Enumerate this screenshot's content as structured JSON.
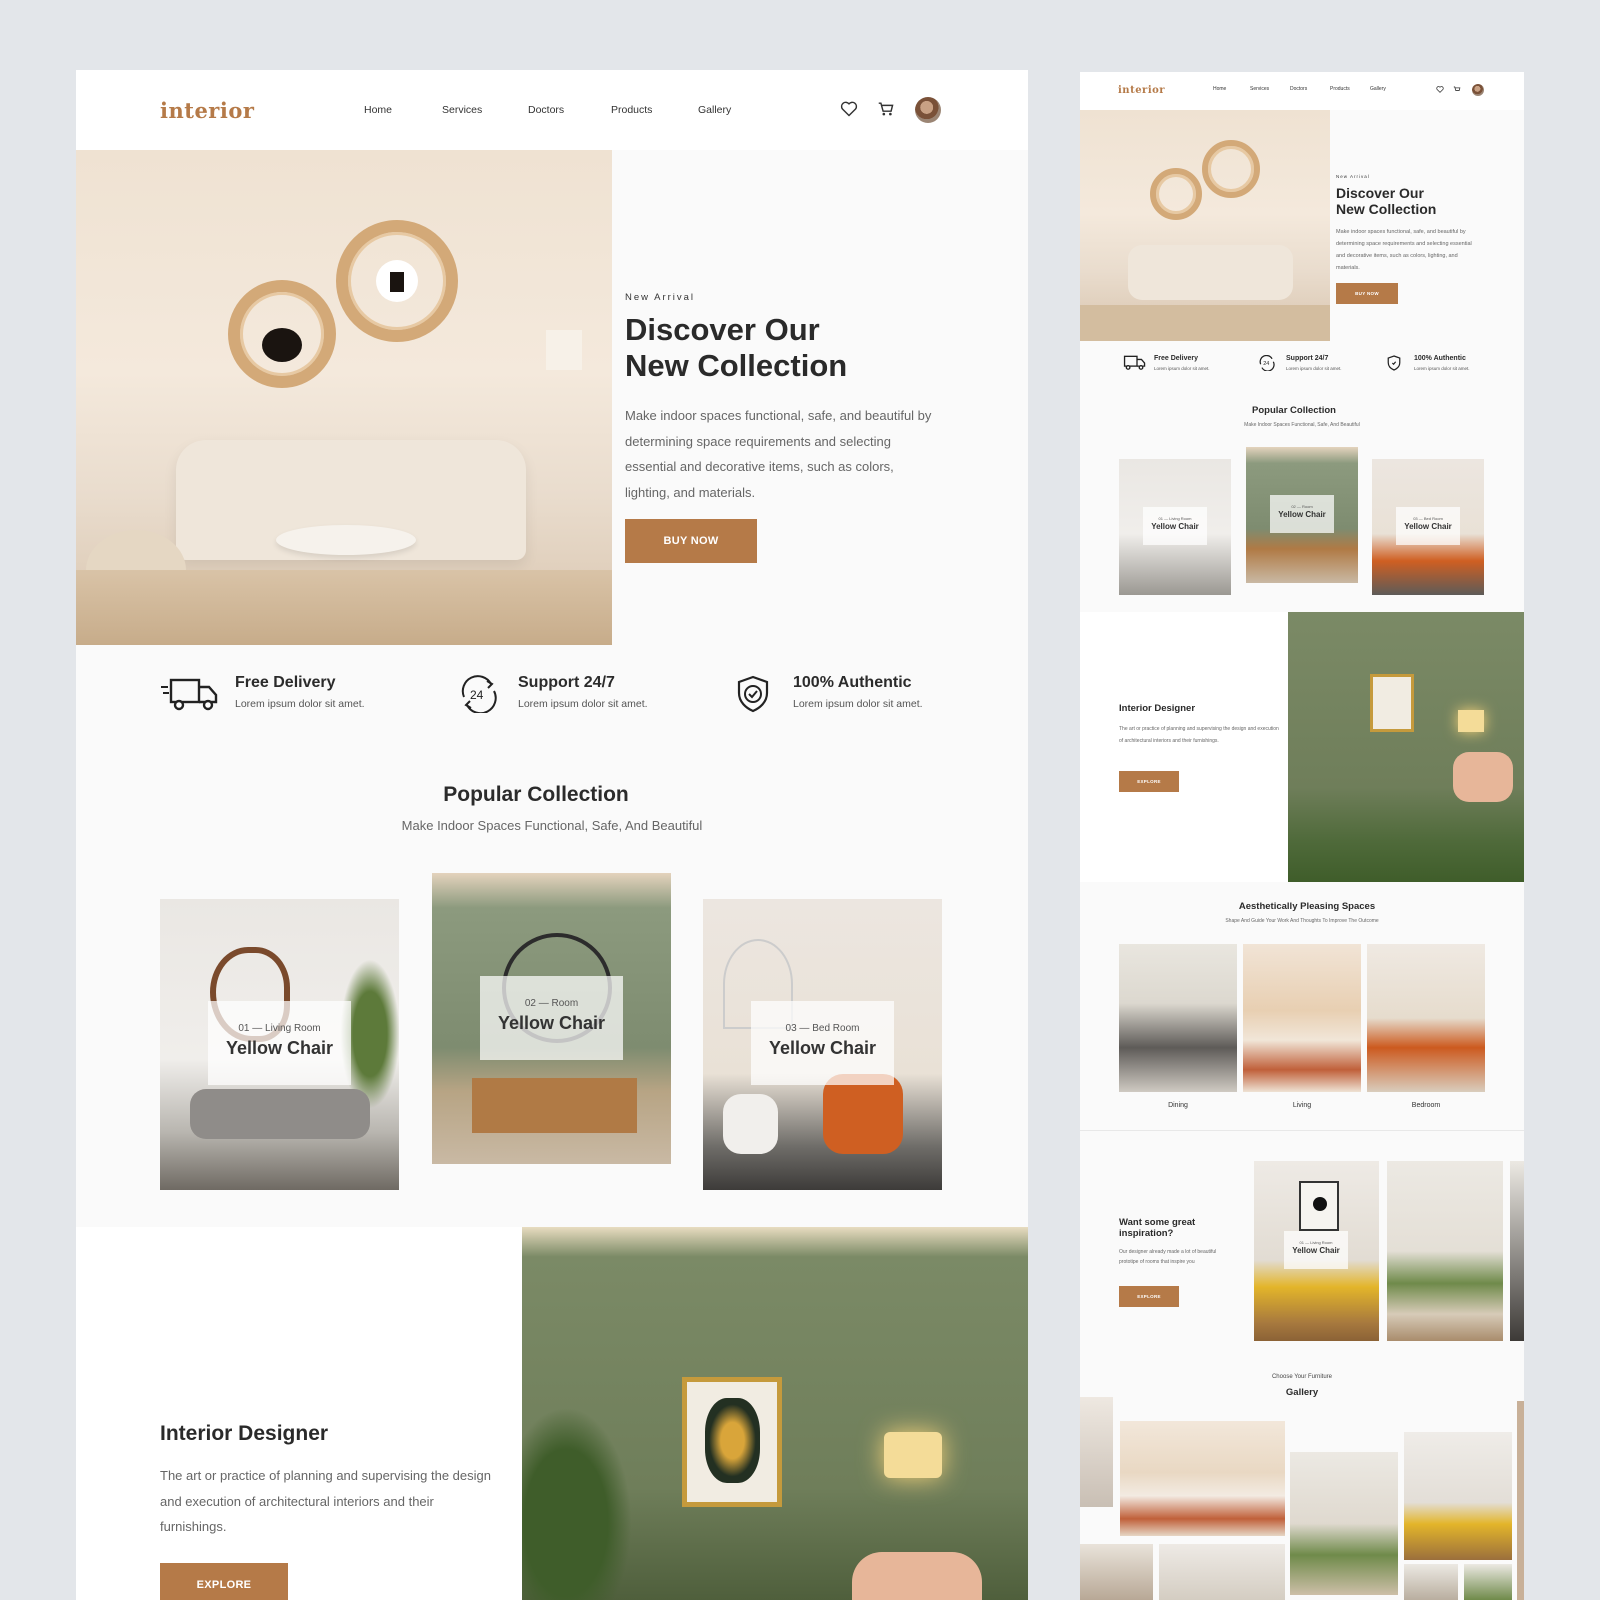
{
  "brand": {
    "logo": "interior",
    "accent": "#b57a48"
  },
  "nav": {
    "links": [
      "Home",
      "Services",
      "Doctors",
      "Products",
      "Gallery"
    ],
    "icons": [
      "heart-icon",
      "cart-icon",
      "avatar"
    ]
  },
  "hero": {
    "eyebrow": "New Arrival",
    "title_line1": "Discover Our",
    "title_line2": "New Collection",
    "description": "Make indoor spaces functional, safe, and beautiful by determining space requirements and selecting essential and decorative items, such as colors, lighting, and materials.",
    "button": "BUY NOW"
  },
  "features": [
    {
      "icon": "truck-icon",
      "title": "Free Delivery",
      "sub": "Lorem ipsum dolor sit amet."
    },
    {
      "icon": "support-24-icon",
      "title": "Support 24/7",
      "sub": "Lorem ipsum dolor sit amet."
    },
    {
      "icon": "shield-check-icon",
      "title": "100% Authentic",
      "sub": "Lorem ipsum dolor sit amet."
    }
  ],
  "popular": {
    "title": "Popular Collection",
    "subtitle": "Make Indoor Spaces Functional, Safe, And Beautiful",
    "cards": [
      {
        "num": "01",
        "room": "Living Room",
        "name": "Yellow Chair"
      },
      {
        "num": "02",
        "room": "Room",
        "name": "Yellow Chair"
      },
      {
        "num": "03",
        "room": "Bed Room",
        "name": "Yellow Chair"
      }
    ]
  },
  "designer": {
    "title": "Interior Designer",
    "description": "The art or practice of planning and supervising the design and execution of architectural interiors and their furnishings.",
    "button": "EXPLORE"
  },
  "aesthetic": {
    "title": "Aesthetically Pleasing Spaces",
    "subtitle": "Shape And Guide Your Work And Thoughts To Improve The Outcome",
    "rooms": [
      "Dining",
      "Living",
      "Bedroom"
    ]
  },
  "inspiration": {
    "title_line1": "Want some great",
    "title_line2": "inspiration?",
    "description": "Our designer already made a lot of beautiful prototipe of rooms that inspire you",
    "button": "EXPLORE",
    "card": {
      "num": "01",
      "room": "Living Room",
      "name": "Yellow Chair"
    }
  },
  "gallery": {
    "eyebrow": "Choose Your Furniture",
    "title": "Gallery"
  }
}
